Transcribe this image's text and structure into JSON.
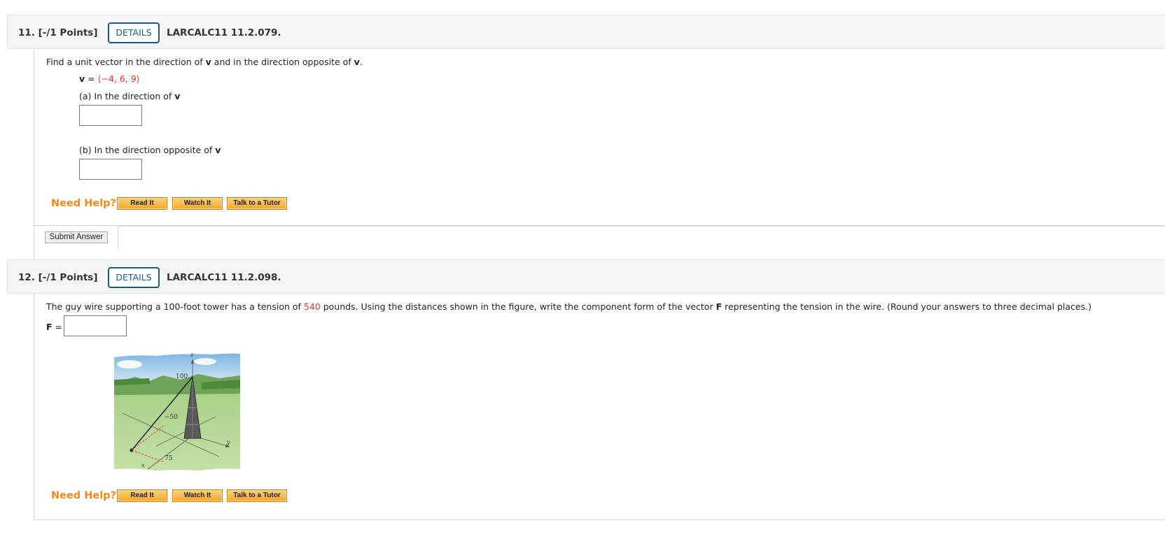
{
  "q11": {
    "number": "11.",
    "points": "[-/1 Points]",
    "details_label": "DETAILS",
    "code": "LARCALC11 11.2.079.",
    "prompt": {
      "a": "Find a unit vector in the direction of ",
      "v1": "v",
      "b": " and in the direction opposite of ",
      "v2": "v",
      "c": "."
    },
    "vector": {
      "name": "v",
      "eq": " = ",
      "lang": "⟨",
      "values": "−4, 6, 9",
      "rang": "⟩"
    },
    "part_a": {
      "label": "(a) In the direction of ",
      "v": "v",
      "value": ""
    },
    "part_b": {
      "label": "(b) In the direction opposite of ",
      "v": "v",
      "value": ""
    },
    "need_help": "Need Help?",
    "read_it": "Read It",
    "watch_it": "Watch It",
    "talk_to_tutor": "Talk to a Tutor",
    "submit": "Submit Answer"
  },
  "q12": {
    "number": "12.",
    "points": "[-/1 Points]",
    "details_label": "DETAILS",
    "code": "LARCALC11 11.2.098.",
    "prompt": {
      "a": "The guy wire supporting a 100-foot tower has a tension of ",
      "tension": "540",
      "b": " pounds. Using the distances shown in the figure, write the component form of the vector ",
      "F": "F",
      "c": " representing the tension in the wire. (Round your answers to three decimal places.)"
    },
    "answer_label": "F",
    "answer_eq": " =",
    "answer_value": "",
    "figure": {
      "label_z": "z",
      "label_100": "100",
      "label_neg50": "−50",
      "label_75": "75",
      "label_y": "y",
      "label_x": "x"
    },
    "need_help": "Need Help?",
    "read_it": "Read It",
    "watch_it": "Watch It",
    "talk_to_tutor": "Talk to a Tutor"
  },
  "colors": {
    "accent_red": "#e8322b",
    "need_help_orange": "#f08a1c",
    "details_blue": "#1a5a8a",
    "button_orange": "#f5a623"
  }
}
